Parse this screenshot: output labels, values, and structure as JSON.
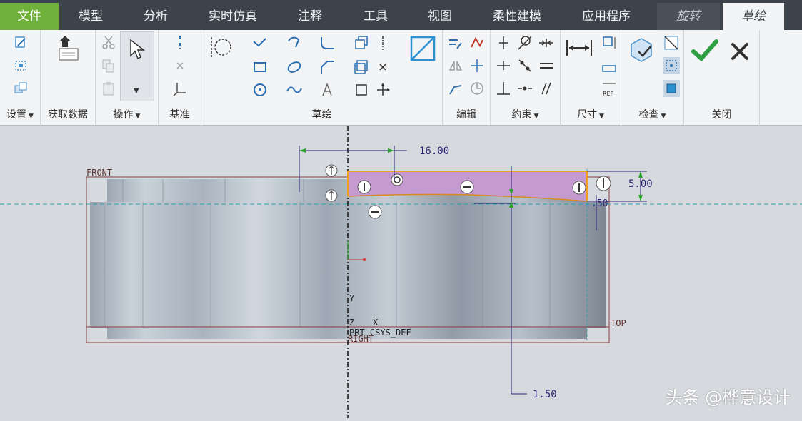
{
  "tabs": [
    {
      "label": "文件"
    },
    {
      "label": "模型"
    },
    {
      "label": "分析"
    },
    {
      "label": "实时仿真"
    },
    {
      "label": "注释"
    },
    {
      "label": "工具"
    },
    {
      "label": "视图"
    },
    {
      "label": "柔性建模"
    },
    {
      "label": "应用程序"
    },
    {
      "label": "旋转"
    },
    {
      "label": "草绘"
    }
  ],
  "groups": {
    "setup": "设置",
    "get_data": "获取数据",
    "operations": "操作",
    "datum": "基准",
    "sketch": "草绘",
    "edit": "编辑",
    "constrain": "约束",
    "dimension": "尺寸",
    "inspect": "检查",
    "close": "关闭"
  },
  "canvas": {
    "dim_horizontal": "16.00",
    "dim_vertical": "5.00",
    "dim_small": ".50",
    "dim_bottom": "1.50",
    "label_front": "FRONT",
    "label_top": "TOP",
    "label_right": "RIGHT",
    "label_csys": "PRT_CSYS_DEF",
    "axis_y": "Y",
    "axis_z": "Z",
    "axis_x": "X"
  },
  "watermark": "头条 @桦意设计",
  "colors": {
    "file_tab": "#6fb13b",
    "sketch_fill": "#c59ad0",
    "sketch_outline": "#f0a020",
    "confirm": "#2ea043",
    "dim_line": "#2a1f6e"
  }
}
